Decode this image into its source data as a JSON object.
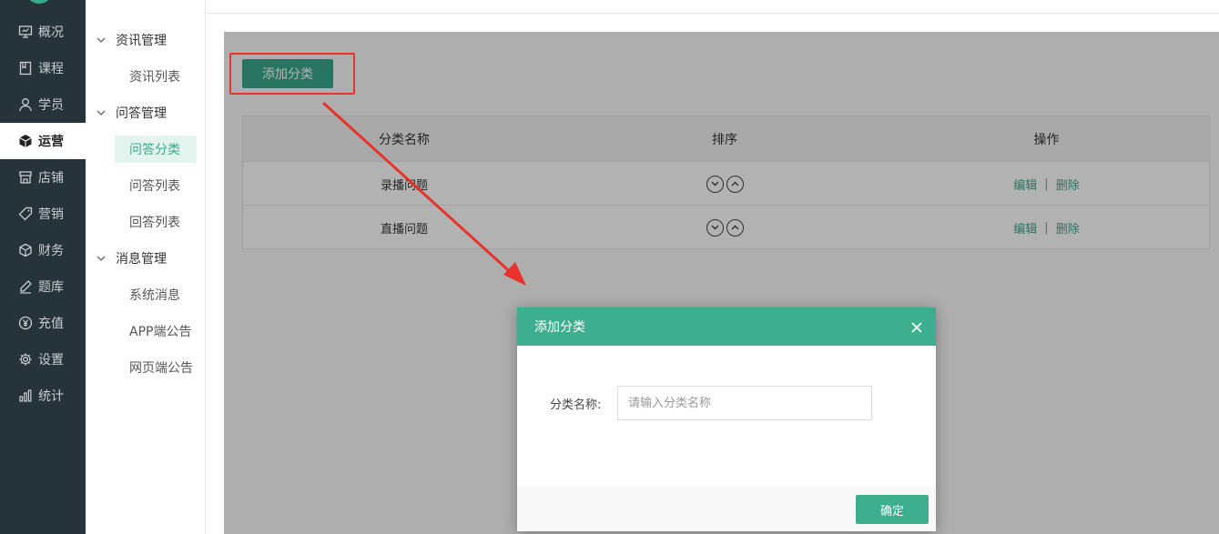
{
  "sidebar": {
    "items": [
      {
        "label": "概况",
        "icon": "monitor-icon"
      },
      {
        "label": "课程",
        "icon": "book-icon"
      },
      {
        "label": "学员",
        "icon": "user-icon"
      },
      {
        "label": "运营",
        "icon": "cube-icon",
        "active": true
      },
      {
        "label": "店铺",
        "icon": "store-icon"
      },
      {
        "label": "营销",
        "icon": "tag-icon"
      },
      {
        "label": "财务",
        "icon": "box-icon"
      },
      {
        "label": "题库",
        "icon": "pen-icon"
      },
      {
        "label": "充值",
        "icon": "yen-icon"
      },
      {
        "label": "设置",
        "icon": "gear-icon"
      },
      {
        "label": "统计",
        "icon": "bar-chart-icon"
      }
    ],
    "accent_color": "#3aaa8c"
  },
  "submenu": {
    "groups": [
      {
        "label": "资讯管理",
        "items": [
          "资讯列表"
        ]
      },
      {
        "label": "问答管理",
        "items": [
          "问答分类",
          "问答列表",
          "回答列表"
        ]
      },
      {
        "label": "消息管理",
        "items": [
          "系统消息",
          "APP端公告",
          "网页端公告"
        ]
      }
    ],
    "active_item": "问答分类"
  },
  "toolbar": {
    "add_label": "添加分类"
  },
  "table": {
    "headers": [
      "分类名称",
      "排序",
      "操作"
    ],
    "rows": [
      {
        "name": "录播问题",
        "edit": "编辑",
        "delete": "删除"
      },
      {
        "name": "直播问题",
        "edit": "编辑",
        "delete": "删除"
      }
    ],
    "separator": "|"
  },
  "dialog": {
    "title": "添加分类",
    "field_label": "分类名称:",
    "field_placeholder": "请输入分类名称",
    "field_value": "",
    "confirm_label": "确定",
    "header_color": "#3daf8f"
  },
  "annotation": {
    "color": "#e8322a"
  }
}
